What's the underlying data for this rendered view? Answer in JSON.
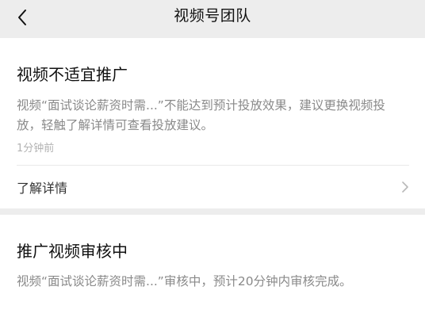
{
  "header": {
    "title": "视频号团队",
    "back_icon": "chevron-left-icon"
  },
  "messages": [
    {
      "title": "视频不适宜推广",
      "body": "视频“面试谈论薪资时需...”不能达到预计投放效果，建议更换视频投放，轻触了解详情可查看投放建议。",
      "time": "1分钟前",
      "detail_label": "了解详情",
      "detail_icon": "chevron-right-icon"
    },
    {
      "title": "推广视频审核中",
      "body": "视频“面试谈论薪资时需...”审核中，预计20分钟内审核完成。"
    }
  ],
  "colors": {
    "background": "#ededed",
    "card": "#ffffff",
    "title_text": "#111111",
    "body_text": "#8a8a8a",
    "time_text": "#b2b2b2"
  }
}
